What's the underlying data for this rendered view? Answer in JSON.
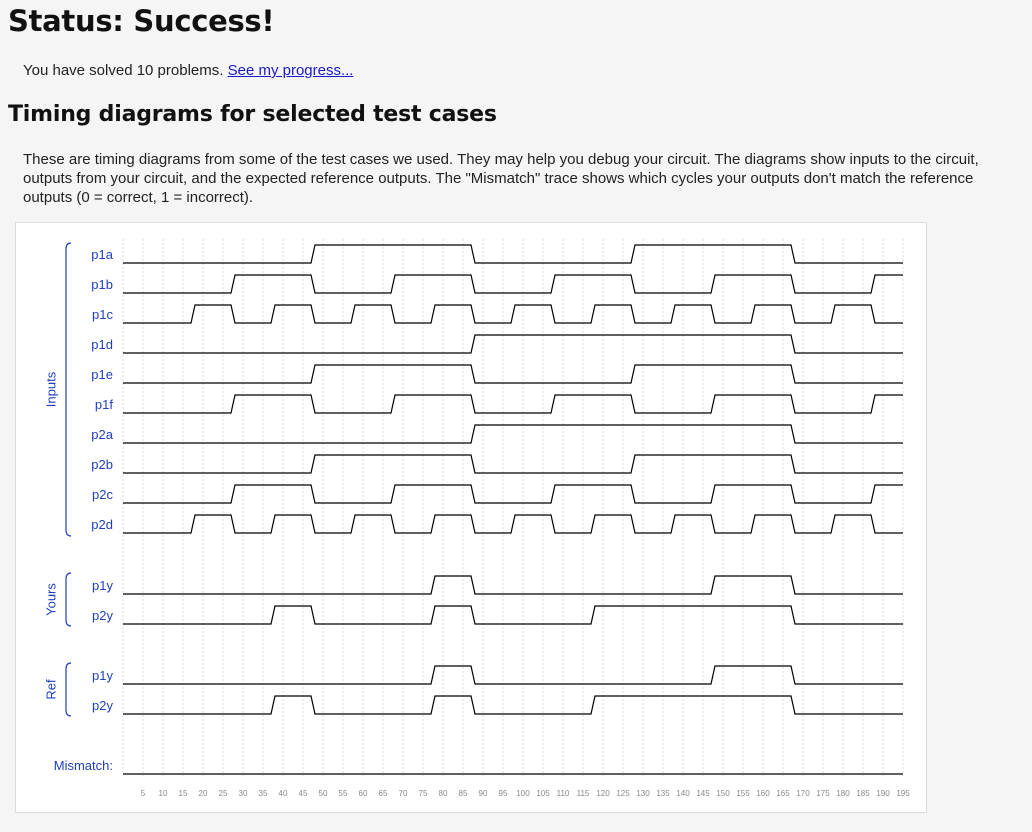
{
  "status": {
    "title": "Status: Success!"
  },
  "progress": {
    "solved_text": "You have solved 10 problems.",
    "link_text": "See my progress..."
  },
  "timing": {
    "heading": "Timing diagrams for selected test cases",
    "description": "These are timing diagrams from some of the test cases we used. They may help you debug your circuit. The diagrams show inputs to the circuit, outputs from your circuit, and the expected reference outputs. The \"Mismatch\" trace shows which cycles your outputs don't match the reference outputs (0 = correct, 1 = incorrect).",
    "groups": [
      {
        "label": "Inputs",
        "signals": [
          "p1a",
          "p1b",
          "p1c",
          "p1d",
          "p1e",
          "p1f",
          "p2a",
          "p2b",
          "p2c",
          "p2d"
        ]
      },
      {
        "label": "Yours",
        "signals": [
          "p1y",
          "p2y"
        ]
      },
      {
        "label": "Ref",
        "signals": [
          "p1y",
          "p2y"
        ]
      }
    ],
    "mismatch_label": "Mismatch:",
    "time_ticks": [
      5,
      10,
      15,
      20,
      25,
      30,
      35,
      40,
      45,
      50,
      55,
      60,
      65,
      70,
      75,
      80,
      85,
      90,
      95,
      100,
      105,
      110,
      115,
      120,
      125,
      130,
      135,
      140,
      145,
      150,
      155,
      160,
      165,
      170,
      175,
      180,
      185,
      190,
      195
    ],
    "colors": {
      "label": "#1f3fbf",
      "trace": "#000000",
      "grid": "#dddddd",
      "tick": "#888888"
    },
    "waves": {
      "inputs": [
        {
          "name": "p1a",
          "transitions": [
            {
              "t": 0,
              "v": 0
            },
            {
              "t": 47,
              "v": 1
            },
            {
              "t": 87,
              "v": 0
            },
            {
              "t": 127,
              "v": 1
            },
            {
              "t": 167,
              "v": 0
            }
          ]
        },
        {
          "name": "p1b",
          "transitions": [
            {
              "t": 0,
              "v": 0
            },
            {
              "t": 27,
              "v": 1
            },
            {
              "t": 47,
              "v": 0
            },
            {
              "t": 67,
              "v": 1
            },
            {
              "t": 87,
              "v": 0
            },
            {
              "t": 107,
              "v": 1
            },
            {
              "t": 127,
              "v": 0
            },
            {
              "t": 147,
              "v": 1
            },
            {
              "t": 167,
              "v": 0
            },
            {
              "t": 187,
              "v": 1
            }
          ]
        },
        {
          "name": "p1c",
          "transitions": [
            {
              "t": 0,
              "v": 0
            },
            {
              "t": 17,
              "v": 1
            },
            {
              "t": 27,
              "v": 0
            },
            {
              "t": 37,
              "v": 1
            },
            {
              "t": 47,
              "v": 0
            },
            {
              "t": 57,
              "v": 1
            },
            {
              "t": 67,
              "v": 0
            },
            {
              "t": 77,
              "v": 1
            },
            {
              "t": 87,
              "v": 0
            },
            {
              "t": 97,
              "v": 1
            },
            {
              "t": 107,
              "v": 0
            },
            {
              "t": 117,
              "v": 1
            },
            {
              "t": 127,
              "v": 0
            },
            {
              "t": 137,
              "v": 1
            },
            {
              "t": 147,
              "v": 0
            },
            {
              "t": 157,
              "v": 1
            },
            {
              "t": 167,
              "v": 0
            },
            {
              "t": 177,
              "v": 1
            },
            {
              "t": 187,
              "v": 0
            }
          ]
        },
        {
          "name": "p1d",
          "transitions": [
            {
              "t": 0,
              "v": 0
            },
            {
              "t": 87,
              "v": 1
            },
            {
              "t": 167,
              "v": 0
            }
          ]
        },
        {
          "name": "p1e",
          "transitions": [
            {
              "t": 0,
              "v": 0
            },
            {
              "t": 47,
              "v": 1
            },
            {
              "t": 87,
              "v": 0
            },
            {
              "t": 127,
              "v": 1
            },
            {
              "t": 167,
              "v": 0
            }
          ]
        },
        {
          "name": "p1f",
          "transitions": [
            {
              "t": 0,
              "v": 0
            },
            {
              "t": 27,
              "v": 1
            },
            {
              "t": 47,
              "v": 0
            },
            {
              "t": 67,
              "v": 1
            },
            {
              "t": 87,
              "v": 0
            },
            {
              "t": 107,
              "v": 1
            },
            {
              "t": 127,
              "v": 0
            },
            {
              "t": 147,
              "v": 1
            },
            {
              "t": 167,
              "v": 0
            },
            {
              "t": 187,
              "v": 1
            }
          ]
        },
        {
          "name": "p2a",
          "transitions": [
            {
              "t": 0,
              "v": 0
            },
            {
              "t": 87,
              "v": 1
            },
            {
              "t": 167,
              "v": 0
            }
          ]
        },
        {
          "name": "p2b",
          "transitions": [
            {
              "t": 0,
              "v": 0
            },
            {
              "t": 47,
              "v": 1
            },
            {
              "t": 87,
              "v": 0
            },
            {
              "t": 127,
              "v": 1
            },
            {
              "t": 167,
              "v": 0
            }
          ]
        },
        {
          "name": "p2c",
          "transitions": [
            {
              "t": 0,
              "v": 0
            },
            {
              "t": 27,
              "v": 1
            },
            {
              "t": 47,
              "v": 0
            },
            {
              "t": 67,
              "v": 1
            },
            {
              "t": 87,
              "v": 0
            },
            {
              "t": 107,
              "v": 1
            },
            {
              "t": 127,
              "v": 0
            },
            {
              "t": 147,
              "v": 1
            },
            {
              "t": 167,
              "v": 0
            },
            {
              "t": 187,
              "v": 1
            }
          ]
        },
        {
          "name": "p2d",
          "transitions": [
            {
              "t": 0,
              "v": 0
            },
            {
              "t": 17,
              "v": 1
            },
            {
              "t": 27,
              "v": 0
            },
            {
              "t": 37,
              "v": 1
            },
            {
              "t": 47,
              "v": 0
            },
            {
              "t": 57,
              "v": 1
            },
            {
              "t": 67,
              "v": 0
            },
            {
              "t": 77,
              "v": 1
            },
            {
              "t": 87,
              "v": 0
            },
            {
              "t": 97,
              "v": 1
            },
            {
              "t": 107,
              "v": 0
            },
            {
              "t": 117,
              "v": 1
            },
            {
              "t": 127,
              "v": 0
            },
            {
              "t": 137,
              "v": 1
            },
            {
              "t": 147,
              "v": 0
            },
            {
              "t": 157,
              "v": 1
            },
            {
              "t": 167,
              "v": 0
            },
            {
              "t": 177,
              "v": 1
            },
            {
              "t": 187,
              "v": 0
            }
          ]
        }
      ],
      "yours": [
        {
          "name": "p1y",
          "transitions": [
            {
              "t": 0,
              "v": 0
            },
            {
              "t": 77,
              "v": 1
            },
            {
              "t": 87,
              "v": 0
            },
            {
              "t": 147,
              "v": 1
            },
            {
              "t": 167,
              "v": 0
            }
          ]
        },
        {
          "name": "p2y",
          "transitions": [
            {
              "t": 0,
              "v": 0
            },
            {
              "t": 37,
              "v": 1
            },
            {
              "t": 47,
              "v": 0
            },
            {
              "t": 77,
              "v": 1
            },
            {
              "t": 87,
              "v": 0
            },
            {
              "t": 117,
              "v": 1
            },
            {
              "t": 167,
              "v": 0
            }
          ]
        }
      ],
      "ref": [
        {
          "name": "p1y",
          "transitions": [
            {
              "t": 0,
              "v": 0
            },
            {
              "t": 77,
              "v": 1
            },
            {
              "t": 87,
              "v": 0
            },
            {
              "t": 147,
              "v": 1
            },
            {
              "t": 167,
              "v": 0
            }
          ]
        },
        {
          "name": "p2y",
          "transitions": [
            {
              "t": 0,
              "v": 0
            },
            {
              "t": 37,
              "v": 1
            },
            {
              "t": 47,
              "v": 0
            },
            {
              "t": 77,
              "v": 1
            },
            {
              "t": 87,
              "v": 0
            },
            {
              "t": 117,
              "v": 1
            },
            {
              "t": 167,
              "v": 0
            }
          ]
        }
      ],
      "mismatch": {
        "transitions": [
          {
            "t": 0,
            "v": 0
          }
        ]
      }
    }
  }
}
